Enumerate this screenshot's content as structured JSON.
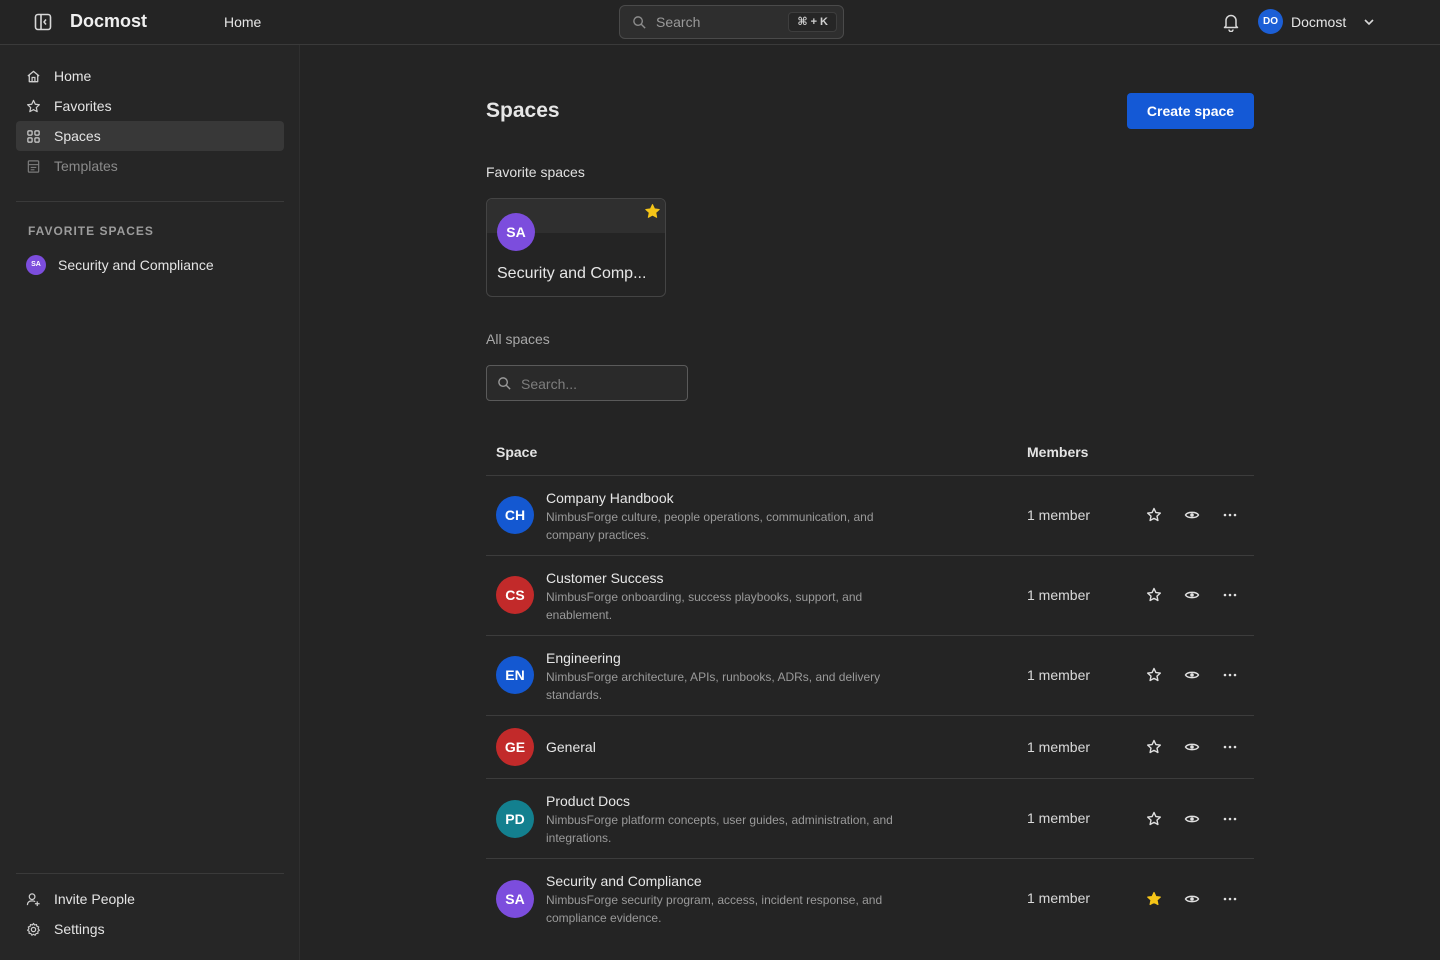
{
  "header": {
    "brand": "Docmost",
    "nav_home": "Home",
    "search_label": "Search",
    "search_shortcut": "⌘ + K",
    "user_initials": "DO",
    "user_name": "Docmost"
  },
  "sidebar": {
    "items": [
      {
        "label": "Home",
        "icon": "home-icon"
      },
      {
        "label": "Favorites",
        "icon": "star-icon"
      },
      {
        "label": "Spaces",
        "icon": "grid-icon",
        "active": true
      },
      {
        "label": "Templates",
        "icon": "template-icon",
        "dimmed": true
      }
    ],
    "favorites_heading": "FAVORITE SPACES",
    "favorites": [
      {
        "initials": "SA",
        "label": "Security and Compliance",
        "color": "#7c4ddd"
      }
    ],
    "bottom": [
      {
        "label": "Invite People",
        "icon": "user-plus-icon"
      },
      {
        "label": "Settings",
        "icon": "gear-icon"
      }
    ]
  },
  "main": {
    "title": "Spaces",
    "create_button": "Create space",
    "favorites_title": "Favorite spaces",
    "favorite_card": {
      "initials": "SA",
      "name": "Security and Comp...",
      "color": "#7c4ddd"
    },
    "all_title": "All spaces",
    "filter_placeholder": "Search...",
    "columns": {
      "space": "Space",
      "members": "Members"
    },
    "rows": [
      {
        "initials": "CH",
        "color": "#1458d1",
        "name": "Company Handbook",
        "desc": "NimbusForge culture, people operations, communication, and company practices.",
        "members": "1 member",
        "favorited": false
      },
      {
        "initials": "CS",
        "color": "#c22a2a",
        "name": "Customer Success",
        "desc": "NimbusForge onboarding, success playbooks, support, and enablement.",
        "members": "1 member",
        "favorited": false
      },
      {
        "initials": "EN",
        "color": "#1458d1",
        "name": "Engineering",
        "desc": "NimbusForge architecture, APIs, runbooks, ADRs, and delivery standards.",
        "members": "1 member",
        "favorited": false
      },
      {
        "initials": "GE",
        "color": "#c22a2a",
        "name": "General",
        "desc": "",
        "members": "1 member",
        "favorited": false
      },
      {
        "initials": "PD",
        "color": "#13808f",
        "name": "Product Docs",
        "desc": "NimbusForge platform concepts, user guides, administration, and integrations.",
        "members": "1 member",
        "favorited": false
      },
      {
        "initials": "SA",
        "color": "#7c4ddd",
        "name": "Security and Compliance",
        "desc": "NimbusForge security program, access, incident response, and compliance evidence.",
        "members": "1 member",
        "favorited": true
      }
    ]
  },
  "colors": {
    "accent": "#1459d6",
    "star_active": "#f5c518"
  }
}
